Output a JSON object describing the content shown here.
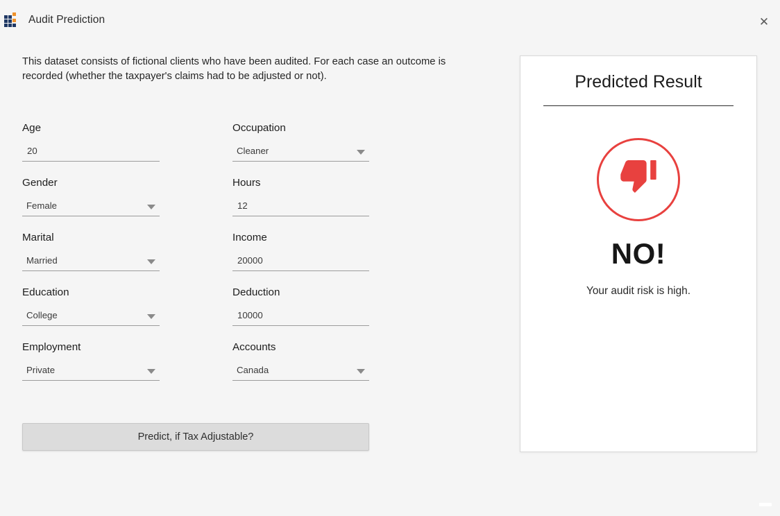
{
  "window": {
    "title": "Audit Prediction",
    "icon_name": "grid-app-icon",
    "close_label": "✕",
    "icon_colors": {
      "primary": "#1f3864",
      "accent": "#f0922b"
    }
  },
  "description": "This dataset consists of fictional clients who have been audited. For each case an outcome is recorded (whether the taxpayer's claims had to be adjusted or not).",
  "form": {
    "left_column": [
      {
        "label": "Age",
        "value": "20",
        "type": "text"
      },
      {
        "label": "Gender",
        "value": "Female",
        "type": "dropdown"
      },
      {
        "label": "Marital",
        "value": "Married",
        "type": "dropdown"
      },
      {
        "label": "Education",
        "value": "College",
        "type": "dropdown"
      },
      {
        "label": "Employment",
        "value": "Private",
        "type": "dropdown"
      }
    ],
    "right_column": [
      {
        "label": "Occupation",
        "value": "Cleaner",
        "type": "dropdown"
      },
      {
        "label": "Hours",
        "value": "12",
        "type": "text"
      },
      {
        "label": "Income",
        "value": "20000",
        "type": "text"
      },
      {
        "label": "Deduction",
        "value": "10000",
        "type": "text"
      },
      {
        "label": "Accounts",
        "value": "Canada",
        "type": "dropdown"
      }
    ],
    "submit_label": "Predict, if Tax Adjustable?"
  },
  "result": {
    "title": "Predicted Result",
    "icon_name": "thumbs-down-icon",
    "verdict": "NO!",
    "message": "Your audit risk is high.",
    "accent_color": "#e8413f"
  }
}
